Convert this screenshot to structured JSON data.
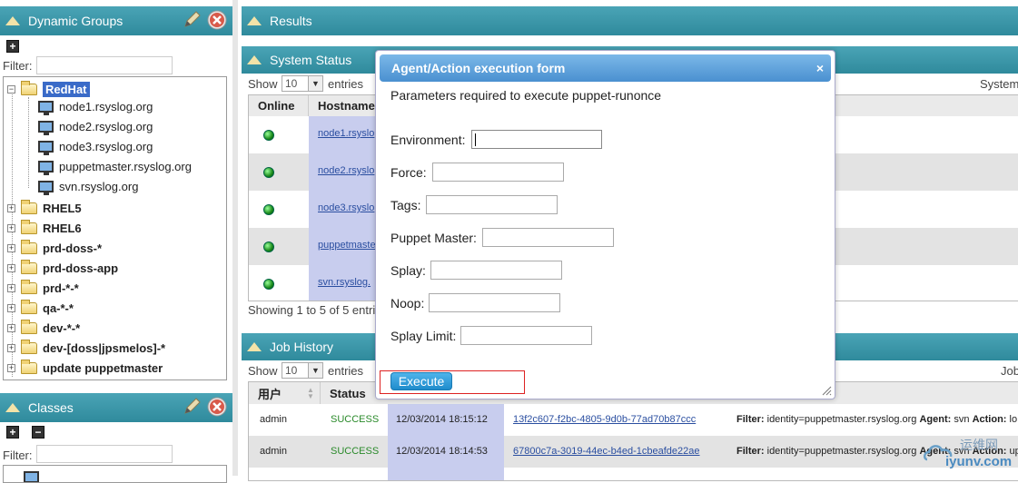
{
  "left_panel": {
    "groups_title": "Dynamic Groups",
    "filter_label": "Filter:",
    "tree": [
      {
        "label": "RedHat",
        "type": "folder-open",
        "selected": true
      },
      {
        "label": "node1.rsyslog.org",
        "type": "host"
      },
      {
        "label": "node2.rsyslog.org",
        "type": "host"
      },
      {
        "label": "node3.rsyslog.org",
        "type": "host"
      },
      {
        "label": "puppetmaster.rsyslog.org",
        "type": "host"
      },
      {
        "label": "svn.rsyslog.org",
        "type": "host"
      },
      {
        "label": "RHEL5",
        "type": "folder"
      },
      {
        "label": "RHEL6",
        "type": "folder"
      },
      {
        "label": "prd-doss-*",
        "type": "folder"
      },
      {
        "label": "prd-doss-app",
        "type": "folder"
      },
      {
        "label": "prd-*-*",
        "type": "folder"
      },
      {
        "label": "qa-*-*",
        "type": "folder"
      },
      {
        "label": "dev-*-*",
        "type": "folder"
      },
      {
        "label": "dev-[doss|jpsmelos]-*",
        "type": "folder"
      },
      {
        "label": "update puppetmaster",
        "type": "folder"
      }
    ],
    "classes_title": "Classes",
    "classes_filter_label": "Filter:"
  },
  "results": {
    "title": "Results"
  },
  "system_status": {
    "title": "System Status",
    "show_label": "Show",
    "show_value": "10",
    "entries_label": "entries",
    "right_label": "System",
    "columns": [
      "Online",
      "Hostname"
    ],
    "rows": [
      {
        "host": "node1.rsyslo"
      },
      {
        "host": "node2.rsyslo"
      },
      {
        "host": "node3.rsyslo"
      },
      {
        "host": "puppetmaste"
      },
      {
        "host": "svn.rsyslog."
      }
    ],
    "footer": "Showing 1 to 5 of 5 entri"
  },
  "job_history": {
    "title": "Job History",
    "show_label": "Show",
    "show_value": "10",
    "entries_label": "entries",
    "right_label": "Job",
    "columns": [
      "用户",
      "Status"
    ],
    "rows": [
      {
        "user": "admin",
        "status": "SUCCESS",
        "time": "12/03/2014 18:15:12",
        "id": "13f2c607-f2bc-4805-9d0b-77ad70b87ccc",
        "filter_label": "Filter:",
        "filter_value": "identity=puppetmaster.rsyslog.org",
        "agent_label": "Agent:",
        "agent_value": "svn",
        "action_label": "Action:",
        "action_value": "lo"
      },
      {
        "user": "admin",
        "status": "SUCCESS",
        "time": "12/03/2014 18:14:53",
        "id": "67800c7a-3019-44ec-b4ed-1cbeafde22ae",
        "filter_label": "Filter:",
        "filter_value": "identity=puppetmaster.rsyslog.org",
        "agent_label": "Agent:",
        "agent_value": "svn",
        "action_label": "Action:",
        "action_value": "up"
      }
    ]
  },
  "modal": {
    "title": "Agent/Action execution form",
    "close": "×",
    "description": "Parameters required to execute puppet-runonce",
    "fields": [
      {
        "label": "Environment:",
        "value": ""
      },
      {
        "label": "Force:",
        "value": ""
      },
      {
        "label": "Tags:",
        "value": ""
      },
      {
        "label": "Puppet Master:",
        "value": ""
      },
      {
        "label": "Splay:",
        "value": ""
      },
      {
        "label": "Noop:",
        "value": ""
      },
      {
        "label": "Splay Limit:",
        "value": ""
      }
    ],
    "execute_label": "Execute"
  },
  "watermark": {
    "text1": "运维网",
    "text2": "iyunv.com"
  },
  "colors": {
    "header": "#3596a8",
    "modal_title": "#5fa3dc",
    "success": "#2a8a2a",
    "highlight": "#c8cdee"
  }
}
